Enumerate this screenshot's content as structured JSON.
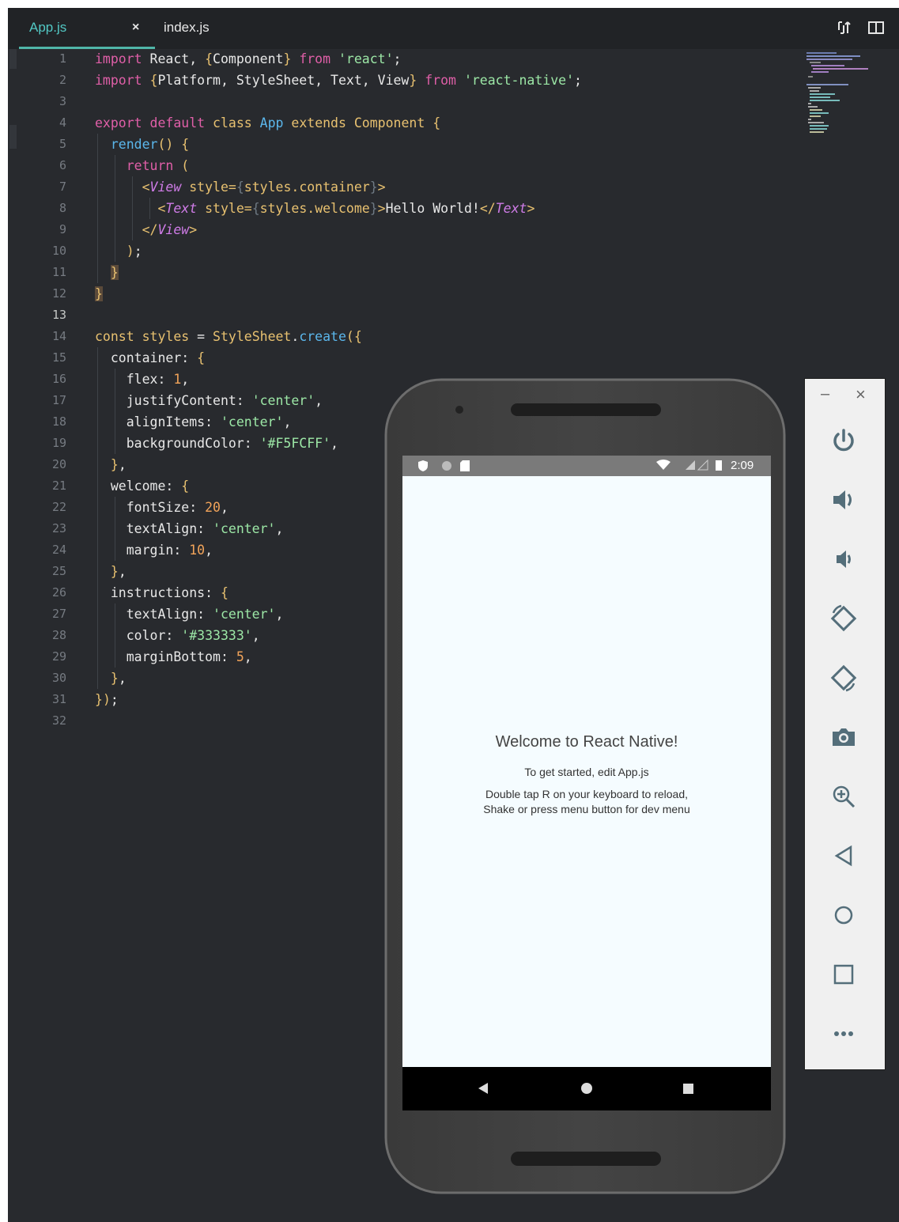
{
  "tabs": [
    {
      "label": "App.js",
      "close": "×",
      "active": true
    },
    {
      "label": "index.js",
      "active": false
    }
  ],
  "icons": {
    "split": "split-panes-icon",
    "layout": "layout-columns-icon"
  },
  "code_lines": [
    {
      "n": "1",
      "html": "<span class=\"k\">import</span> React, <span class=\"p\">{</span>Component<span class=\"p\">}</span> <span class=\"k\">from</span> <span class=\"s\">'react'</span>;"
    },
    {
      "n": "2",
      "html": "<span class=\"k\">import</span> <span class=\"p\">{</span>Platform, StyleSheet, Text, View<span class=\"p\">}</span> <span class=\"k\">from</span> <span class=\"s\">'react-native'</span>;"
    },
    {
      "n": "3",
      "html": ""
    },
    {
      "n": "4",
      "html": "<span class=\"k\">export</span> <span class=\"k\">default</span> <span class=\"p\">class</span> <span class=\"f\">App</span> <span class=\"p\">extends</span> <span class=\"p\">Component</span> <span class=\"p\">{</span>"
    },
    {
      "n": "5",
      "html": "  <span class=\"f\">render</span><span class=\"p\">()</span> <span class=\"p\">{</span>"
    },
    {
      "n": "6",
      "html": "    <span class=\"k\">return</span> <span class=\"p\">(</span>"
    },
    {
      "n": "7",
      "html": "      <span class=\"p\">&lt;</span><span class=\"t\">View</span> <span class=\"p\">style=</span><span class=\"x\">{</span><span class=\"p\">styles.container</span><span class=\"x\">}</span><span class=\"p\">&gt;</span>"
    },
    {
      "n": "8",
      "html": "        <span class=\"p\">&lt;</span><span class=\"t\">Text</span> <span class=\"p\">style=</span><span class=\"x\">{</span><span class=\"p\">styles.welcome</span><span class=\"x\">}</span><span class=\"p\">&gt;</span>Hello World!<span class=\"p\">&lt;/</span><span class=\"t\">Text</span><span class=\"p\">&gt;</span>"
    },
    {
      "n": "9",
      "html": "      <span class=\"p\">&lt;/</span><span class=\"t\">View</span><span class=\"p\">&gt;</span>"
    },
    {
      "n": "10",
      "html": "    <span class=\"p\">)</span>;"
    },
    {
      "n": "11",
      "html": "  <span class=\"p bm\">}</span>"
    },
    {
      "n": "12",
      "html": "<span class=\"p bm\">}</span>"
    },
    {
      "n": "13",
      "html": ""
    },
    {
      "n": "14",
      "html": "<span class=\"p\">const</span> <span class=\"p\">styles</span> = <span class=\"p\">StyleSheet</span>.<span class=\"f\">create</span><span class=\"p\">({</span>"
    },
    {
      "n": "15",
      "html": "  container: <span class=\"p\">{</span>"
    },
    {
      "n": "16",
      "html": "    flex: <span class=\"n\">1</span>,"
    },
    {
      "n": "17",
      "html": "    justifyContent: <span class=\"s\">'center'</span>,"
    },
    {
      "n": "18",
      "html": "    alignItems: <span class=\"s\">'center'</span>,"
    },
    {
      "n": "19",
      "html": "    backgroundColor: <span class=\"s\">'#F5FCFF'</span>,"
    },
    {
      "n": "20",
      "html": "  <span class=\"p\">}</span>,"
    },
    {
      "n": "21",
      "html": "  welcome: <span class=\"p\">{</span>"
    },
    {
      "n": "22",
      "html": "    fontSize: <span class=\"n\">20</span>,"
    },
    {
      "n": "23",
      "html": "    textAlign: <span class=\"s\">'center'</span>,"
    },
    {
      "n": "24",
      "html": "    margin: <span class=\"n\">10</span>,"
    },
    {
      "n": "25",
      "html": "  <span class=\"p\">}</span>,"
    },
    {
      "n": "26",
      "html": "  instructions: <span class=\"p\">{</span>"
    },
    {
      "n": "27",
      "html": "    textAlign: <span class=\"s\">'center'</span>,"
    },
    {
      "n": "28",
      "html": "    color: <span class=\"s\">'#333333'</span>,"
    },
    {
      "n": "29",
      "html": "    marginBottom: <span class=\"n\">5</span>,"
    },
    {
      "n": "30",
      "html": "  <span class=\"p\">}</span>,"
    },
    {
      "n": "31",
      "html": "<span class=\"p\">}</span><span class=\"p\">)</span>;"
    },
    {
      "n": "32",
      "html": ""
    }
  ],
  "active_line": "13",
  "emulator": {
    "clock": "2:09",
    "welcome": "Welcome to React Native!",
    "get_started": "To get started, edit App.js",
    "reload_line1": "Double tap R on your keyboard to reload,",
    "reload_line2": "Shake or press menu button for dev menu",
    "screen_bg": "#F5FCFF"
  },
  "toolbar": {
    "minimize": "–",
    "close": "×",
    "buttons": [
      "power-icon",
      "volume-up-icon",
      "volume-down-icon",
      "rotate-left-icon",
      "rotate-right-icon",
      "camera-icon",
      "zoom-icon",
      "back-icon",
      "home-icon",
      "overview-icon",
      "more-icon"
    ]
  },
  "colors": {
    "editor_bg": "#282a2e",
    "accent": "#52c8c4",
    "keyword": "#e05fa8",
    "string": "#9ce7a6",
    "number": "#f2a45a"
  }
}
